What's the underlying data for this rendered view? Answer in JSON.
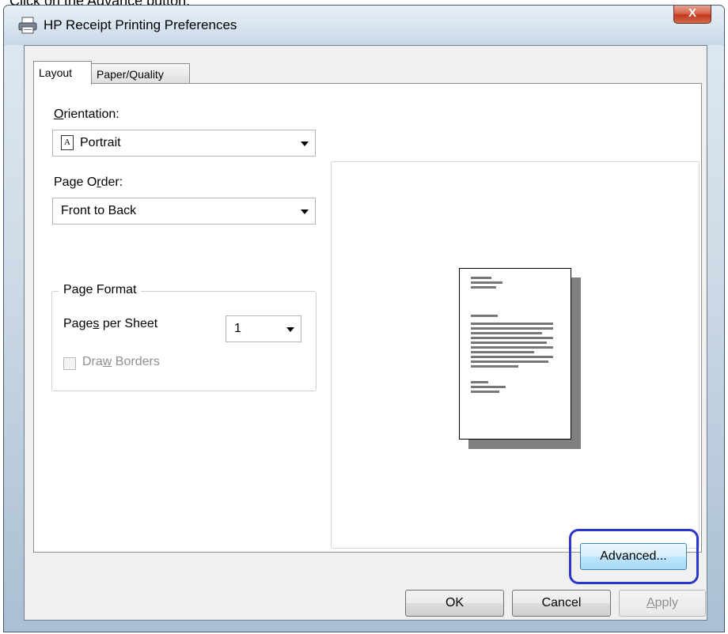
{
  "instruction": "Click on the Advance button.",
  "window": {
    "title": "HP  Receipt Printing Preferences",
    "close_label": "X"
  },
  "tabs": [
    {
      "label": "Layout",
      "active": true
    },
    {
      "label": "Paper/Quality",
      "active": false
    }
  ],
  "orientation": {
    "label_prefix": "",
    "label_mnemonic": "O",
    "label_rest": "rientation:",
    "value": "Portrait",
    "icon_letter": "A"
  },
  "page_order": {
    "label_a": "Page O",
    "label_mnemonic": "r",
    "label_b": "der:",
    "value": "Front to Back"
  },
  "page_format": {
    "legend": "Page Format",
    "pages_per_sheet_a": "Page",
    "pages_per_sheet_mnemonic": "s",
    "pages_per_sheet_b": " per Sheet",
    "pages_per_sheet_value": "1",
    "draw_borders_a": "Dra",
    "draw_borders_mnemonic": "w",
    "draw_borders_b": " Borders",
    "draw_borders_checked": false,
    "draw_borders_enabled": false
  },
  "buttons": {
    "advanced": "Advanced...",
    "ok": "OK",
    "cancel": "Cancel",
    "apply_mnemonic": "A",
    "apply_rest": "pply"
  },
  "colors": {
    "highlight": "#2c36c8",
    "close_button": "#c2391f"
  }
}
